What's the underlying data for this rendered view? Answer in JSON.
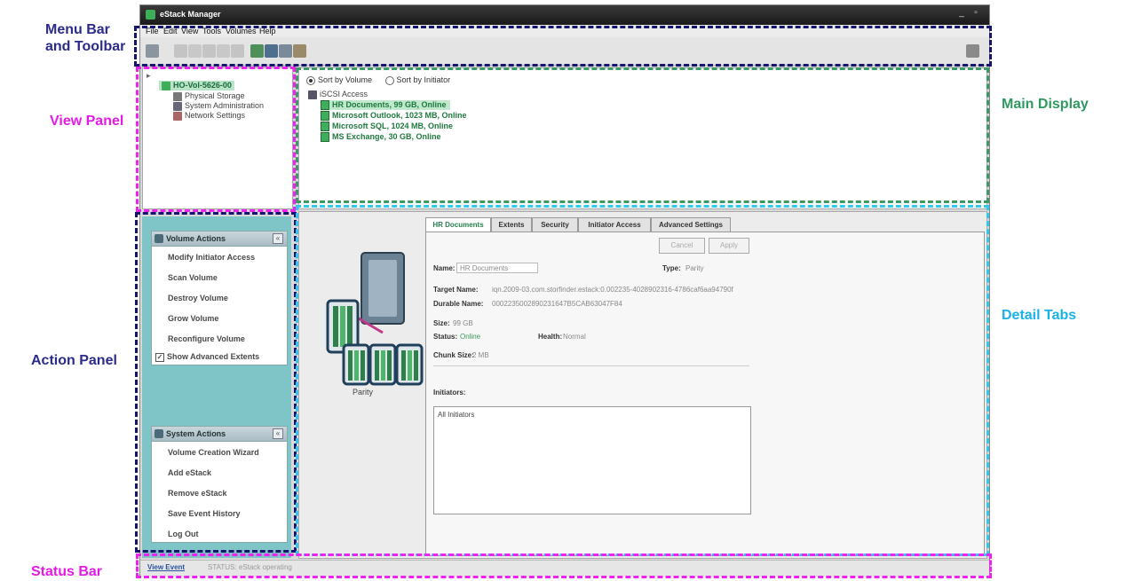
{
  "annotations": {
    "menu_toolbar": "Menu Bar\nand Toolbar",
    "view_panel": "View Panel",
    "main_display": "Main Display",
    "detail_tabs": "Detail Tabs",
    "action_panel": "Action Panel",
    "status_bar": "Status Bar"
  },
  "window": {
    "title": "eStack Manager"
  },
  "menu": {
    "items": [
      "File",
      "Edit",
      "View",
      "Tools",
      "Volumes",
      "Help"
    ]
  },
  "toolbar": {
    "button_icons": [
      "grid-icon",
      "cut-icon",
      "copy-icon",
      "paste-icon",
      "delete-icon",
      "properties-icon",
      "storage-icon",
      "volume-icon",
      "system-icon",
      "network-icon",
      "help-icon"
    ]
  },
  "view_panel": {
    "root": "HO-Vol-5626-00",
    "children": [
      "Physical Storage",
      "System Administration",
      "Network Settings"
    ]
  },
  "main_display": {
    "sort_by_volume": "Sort by Volume",
    "sort_by_initiator": "Sort by Initiator",
    "group": "iSCSI Access",
    "volumes": [
      "HR Documents, 99 GB, Online",
      "Microsoft Outlook, 1023 MB, Online",
      "Microsoft SQL, 1024 MB, Online",
      "MS Exchange, 30 GB, Online"
    ]
  },
  "action_panel": {
    "volume_actions_title": "Volume Actions",
    "volume_actions": [
      "Modify Initiator Access",
      "Scan Volume",
      "Destroy Volume",
      "Grow Volume",
      "Reconfigure Volume"
    ],
    "show_advanced": "Show Advanced Extents",
    "system_actions_title": "System Actions",
    "system_actions": [
      "Volume Creation Wizard",
      "Add eStack",
      "Remove eStack",
      "Save Event History",
      "Log Out"
    ]
  },
  "detail": {
    "raid_label": "Parity",
    "tabs": [
      "HR Documents",
      "Extents",
      "Security",
      "Initiator Access",
      "Advanced Settings"
    ],
    "cancel": "Cancel",
    "apply": "Apply",
    "name_label": "Name:",
    "name_value": "HR Documents",
    "type_label": "Type:",
    "type_value": "Parity",
    "target_label": "Target Name:",
    "target_value": "iqn.2009-03.com.storfinder.estack:0.002235-4028902316-4786caf6aa94790f",
    "durable_label": "Durable Name:",
    "durable_value": "0002235002890231647B5CAB63047F84",
    "size_label": "Size:",
    "size_value": "99 GB",
    "status_label": "Status:",
    "status_value": "Online",
    "health_label": "Health:",
    "health_value": "Normal",
    "chunk_label": "Chunk Size:",
    "chunk_value": "2 MB",
    "initiators_label": "Initiators:",
    "initiators_value": "All Initiators"
  },
  "status_bar": {
    "tab": "View Event",
    "text": "STATUS: eStack operating"
  }
}
